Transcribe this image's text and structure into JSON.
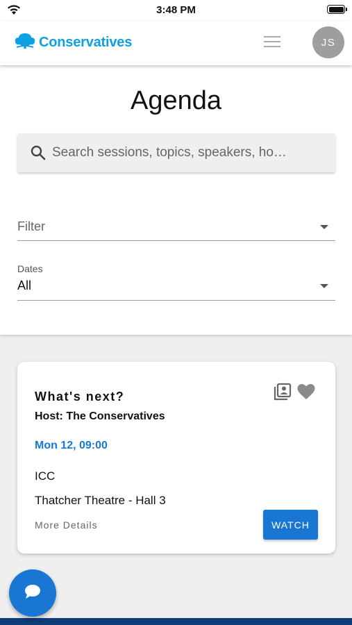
{
  "status_bar": {
    "time": "3:48 PM"
  },
  "header": {
    "brand": "Conservatives",
    "brand_color": "#0da0e3",
    "avatar_initials": "JS",
    "icons": [
      "tree-logo-icon",
      "hamburger-menu-icon"
    ]
  },
  "agenda": {
    "title": "Agenda",
    "search": {
      "placeholder": "Search sessions, topics, speakers, ho…",
      "icon": "search-icon"
    },
    "filter": {
      "placeholder": "Filter"
    },
    "dates": {
      "label": "Dates",
      "value": "All"
    }
  },
  "session": {
    "title": "What's next?",
    "host": "Host: The Conservatives",
    "time": "Mon 12, 09:00",
    "venue": "ICC",
    "room": "Thatcher Theatre - Hall 3",
    "more_details": "More Details",
    "watch_label": "WATCH",
    "accent_color": "#1976d2",
    "icons": [
      "playlist-icon",
      "heart-icon"
    ]
  },
  "fab": {
    "icon": "chat-bubble-icon"
  }
}
